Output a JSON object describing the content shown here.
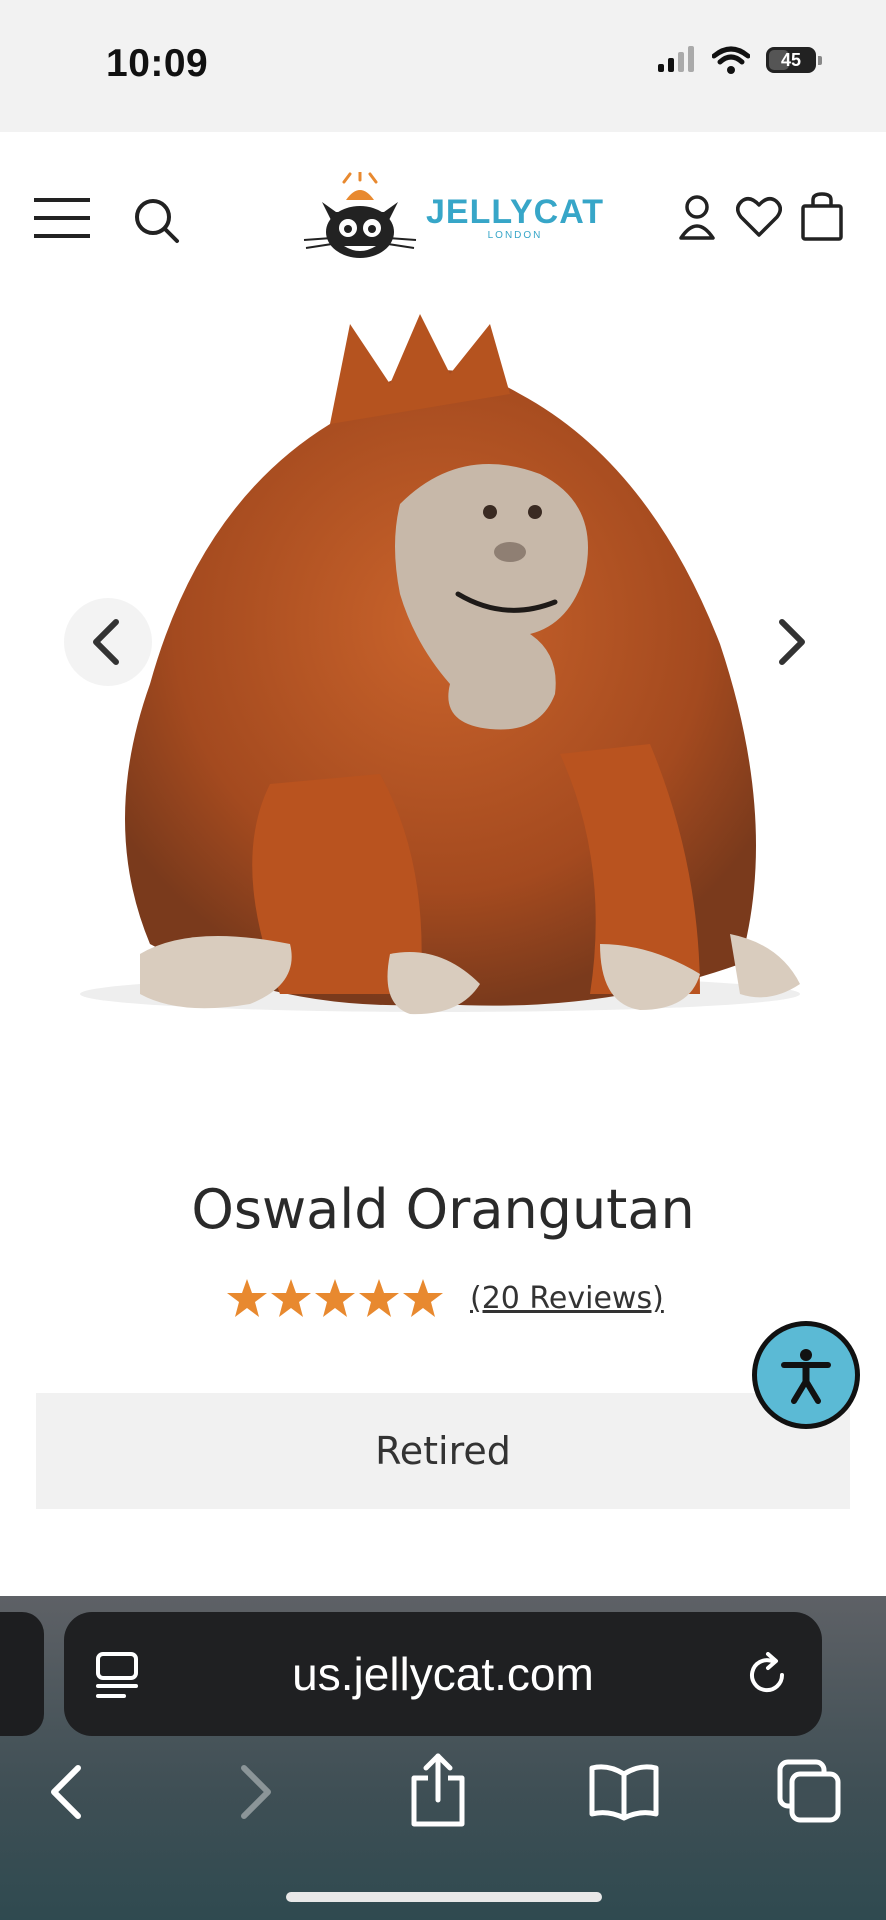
{
  "status_bar": {
    "time": "10:09",
    "battery": "45"
  },
  "header": {
    "logo_word": "JELLYCAT",
    "logo_sub": "LONDON"
  },
  "product": {
    "title": "Oswald Orangutan",
    "rating": 5,
    "reviews": "(20 Reviews)",
    "status": "Retired"
  },
  "browser": {
    "url": "us.jellycat.com"
  },
  "colors": {
    "brand": "#37a6c8",
    "star": "#e8892f",
    "accessibility": "#5bbad5"
  },
  "icons": [
    "menu-icon",
    "search-icon",
    "account-icon",
    "wishlist-icon",
    "bag-icon",
    "chevron-left-icon",
    "chevron-right-icon",
    "accessibility-icon",
    "reader-icon",
    "reload-icon",
    "back-icon",
    "forward-icon",
    "share-icon",
    "bookmarks-icon",
    "tabs-icon"
  ]
}
